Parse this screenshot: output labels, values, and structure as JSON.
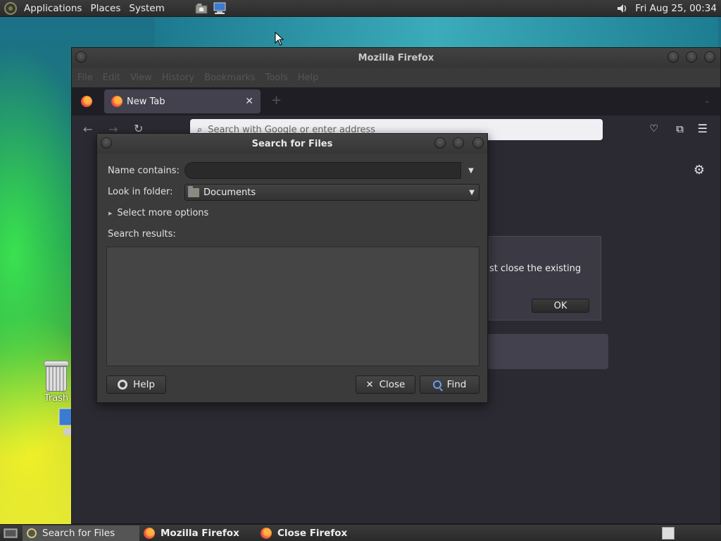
{
  "top_panel": {
    "menus": [
      "Applications",
      "Places",
      "System"
    ],
    "clock": "Fri Aug 25, 00:34"
  },
  "desktop": {
    "trash_label": "Trash"
  },
  "firefox": {
    "title": "Mozilla Firefox",
    "menus": [
      "File",
      "Edit",
      "View",
      "History",
      "Bookmarks",
      "Tools",
      "Help"
    ],
    "tab_label": "New Tab",
    "url_placeholder": "Search with Google or enter address",
    "dialog_text": "st close the existing",
    "dialog_ok": "OK"
  },
  "search_dialog": {
    "title": "Search for Files",
    "name_label": "Name contains:",
    "name_value": "",
    "folder_label": "Look in folder:",
    "folder_value": "Documents",
    "more_options": "Select more options",
    "results_label": "Search results:",
    "help_button": "Help",
    "close_button": "Close",
    "find_button": "Find"
  },
  "taskbar": {
    "tasks": [
      {
        "label": "Search for Files",
        "active": true
      },
      {
        "label": "Mozilla Firefox",
        "active": false
      },
      {
        "label": "Close Firefox",
        "active": false
      }
    ]
  }
}
